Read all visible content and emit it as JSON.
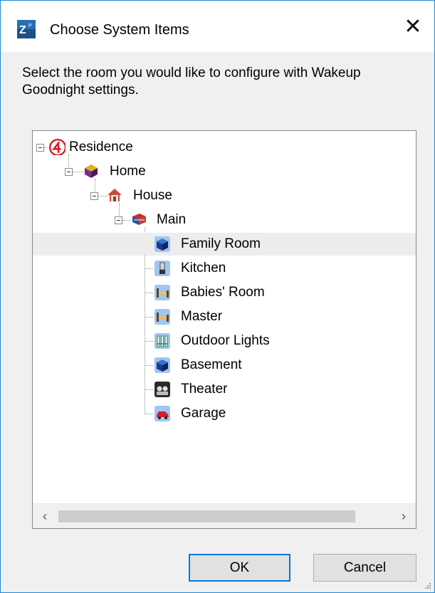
{
  "window": {
    "title": "Choose System Items",
    "close_glyph": "✕"
  },
  "description": "Select the room you would like to configure with Wakeup  Goodnight settings.",
  "tree": {
    "nodes": [
      {
        "label": "Residence",
        "icon": "control4-logo-icon",
        "level": 0,
        "expanded": true
      },
      {
        "label": "Home",
        "icon": "home-cube-icon",
        "level": 1,
        "expanded": true
      },
      {
        "label": "House",
        "icon": "house-icon",
        "level": 2,
        "expanded": true
      },
      {
        "label": "Main",
        "icon": "floor-icon",
        "level": 3,
        "expanded": true
      },
      {
        "label": "Family Room",
        "icon": "room-cube-icon",
        "level": 4,
        "selected": true
      },
      {
        "label": "Kitchen",
        "icon": "blender-icon",
        "level": 4
      },
      {
        "label": "Babies' Room",
        "icon": "bed-icon",
        "level": 4
      },
      {
        "label": "Master",
        "icon": "bed-icon",
        "level": 4
      },
      {
        "label": "Outdoor Lights",
        "icon": "fence-icon",
        "level": 4
      },
      {
        "label": "Basement",
        "icon": "room-cube-icon",
        "level": 4
      },
      {
        "label": "Theater",
        "icon": "theater-icon",
        "level": 4
      },
      {
        "label": "Garage",
        "icon": "car-icon",
        "level": 4
      }
    ]
  },
  "scrollbar": {
    "left_arrow": "‹",
    "right_arrow": "›"
  },
  "buttons": {
    "ok": "OK",
    "cancel": "Cancel"
  },
  "colors": {
    "accent": "#0078d7",
    "selection": "#ededed"
  }
}
